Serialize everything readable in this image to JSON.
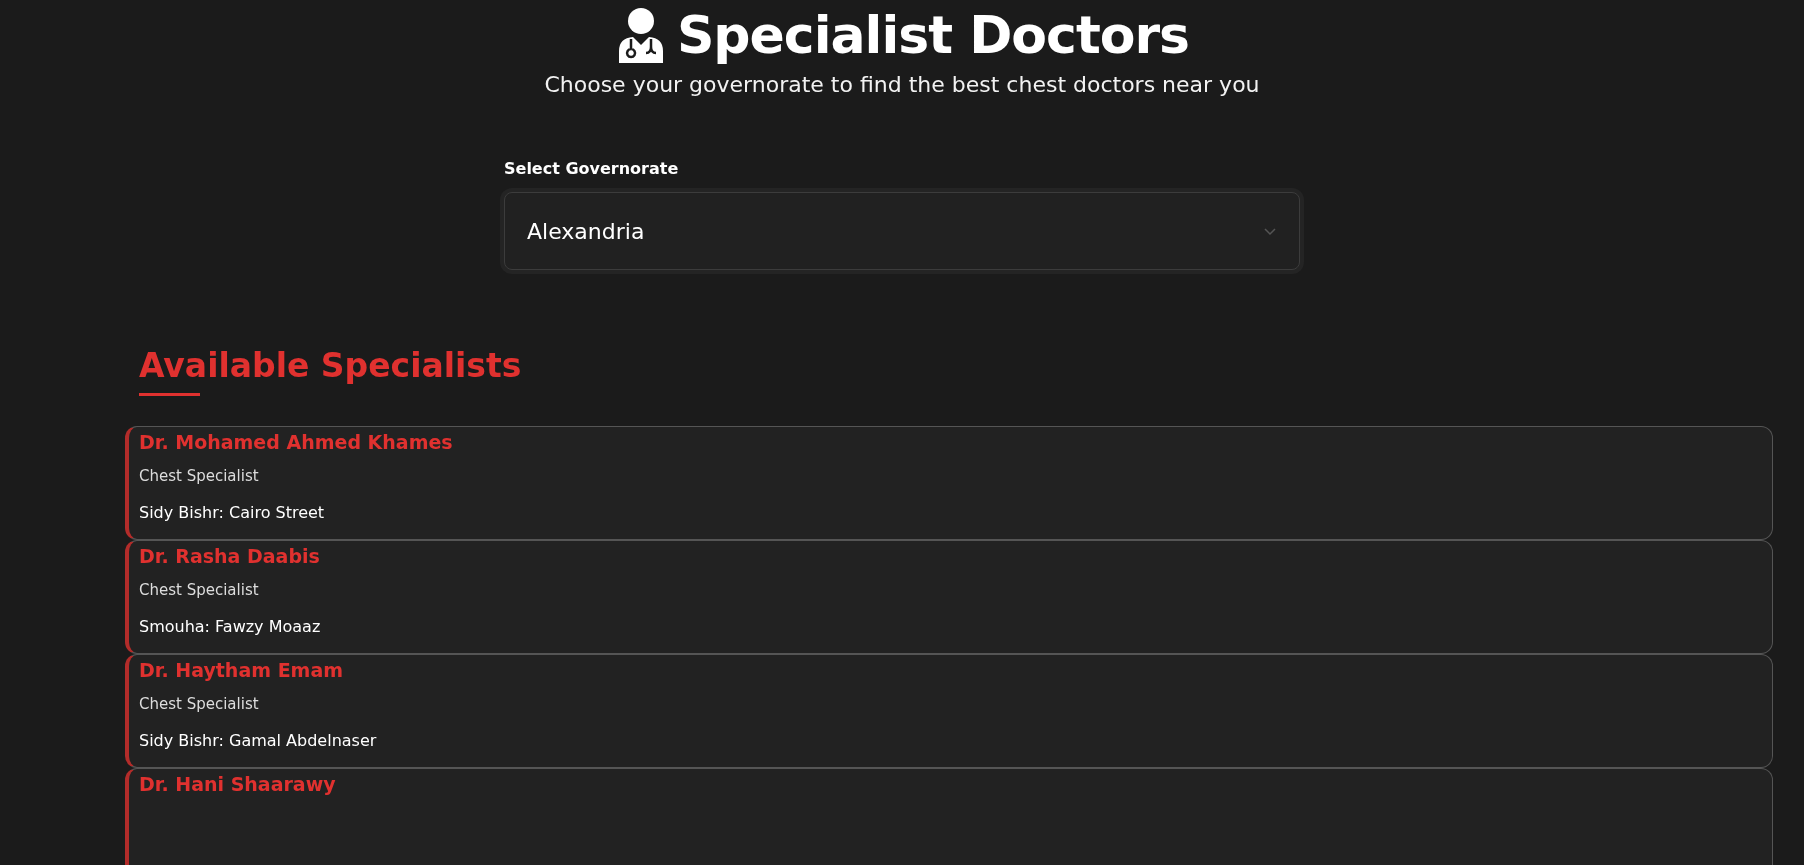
{
  "header": {
    "title": "Specialist Doctors",
    "subtitle": "Choose your governorate to find the best chest doctors near you"
  },
  "governorate": {
    "label": "Select Governorate",
    "value": "Alexandria"
  },
  "specialists": {
    "heading": "Available Specialists",
    "doctors": [
      {
        "name": "Dr. Mohamed Ahmed Khames",
        "specialty": "Chest Specialist",
        "address": "Sidy Bishr: Cairo Street"
      },
      {
        "name": "Dr. Rasha Daabis",
        "specialty": "Chest Specialist",
        "address": "Smouha: Fawzy Moaaz"
      },
      {
        "name": "Dr. Haytham Emam",
        "specialty": "Chest Specialist",
        "address": "Sidy Bishr: Gamal Abdelnaser"
      },
      {
        "name": "Dr. Hani Shaarawy"
      }
    ]
  }
}
